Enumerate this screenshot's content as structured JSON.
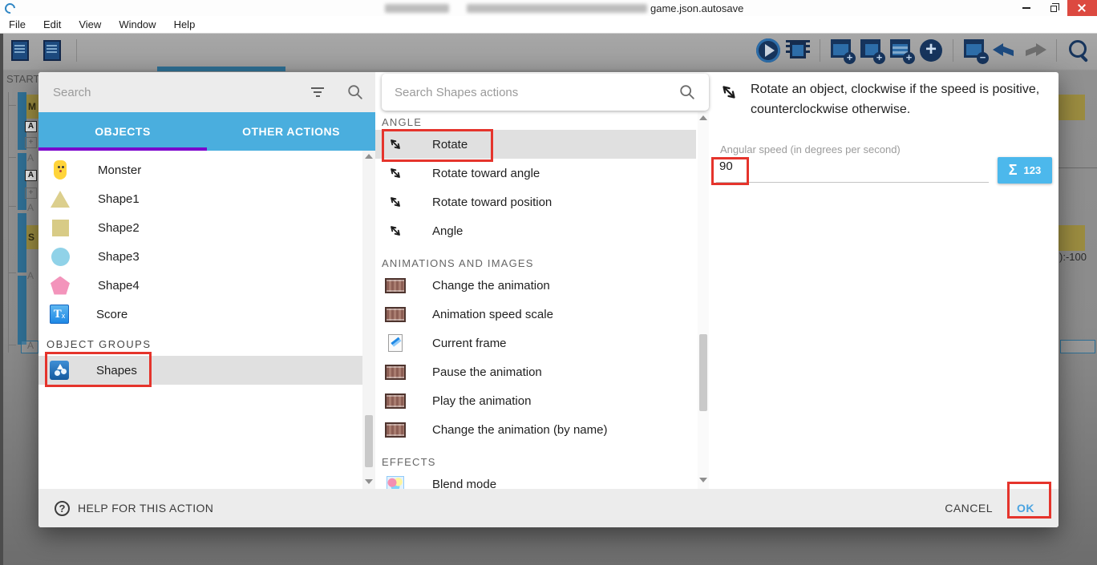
{
  "window": {
    "title": "game.json.autosave"
  },
  "menu": {
    "items": [
      "File",
      "Edit",
      "View",
      "Window",
      "Help"
    ]
  },
  "toolbar": {
    "left_icons": [
      "project-manager",
      "scene-editor"
    ],
    "right_icons": [
      "play",
      "debug",
      "add-event",
      "add-subevent",
      "add-comment",
      "add-circle",
      "delete-event",
      "undo",
      "redo",
      "search"
    ]
  },
  "background": {
    "scene_tab": "START",
    "comment_m": "M",
    "comment_s": "S",
    "action_letter": "A",
    "add_letter": "+",
    "right_text": "):-100"
  },
  "dialog": {
    "objects_panel": {
      "search_placeholder": "Search",
      "tabs": [
        {
          "label": "OBJECTS",
          "active": true
        },
        {
          "label": "OTHER ACTIONS",
          "active": false
        }
      ],
      "objects": [
        {
          "label": "Monster",
          "icon": "monster"
        },
        {
          "label": "Shape1",
          "icon": "triangle"
        },
        {
          "label": "Shape2",
          "icon": "square"
        },
        {
          "label": "Shape3",
          "icon": "circle"
        },
        {
          "label": "Shape4",
          "icon": "pentagon"
        },
        {
          "label": "Score",
          "icon": "text"
        }
      ],
      "groups_header": "OBJECT GROUPS",
      "groups": [
        {
          "label": "Shapes",
          "icon": "group",
          "selected": true
        }
      ]
    },
    "actions_panel": {
      "search_placeholder": "Search Shapes actions",
      "sections": [
        {
          "header": "ANGLE",
          "items": [
            {
              "label": "Rotate",
              "icon": "rotate-arrow",
              "selected": true
            },
            {
              "label": "Rotate toward angle",
              "icon": "rotate-arrow"
            },
            {
              "label": "Rotate toward position",
              "icon": "rotate-arrow"
            },
            {
              "label": "Angle",
              "icon": "rotate-arrow"
            }
          ]
        },
        {
          "header": "ANIMATIONS AND IMAGES",
          "items": [
            {
              "label": "Change the animation",
              "icon": "filmstrip"
            },
            {
              "label": "Animation speed scale",
              "icon": "filmstrip"
            },
            {
              "label": "Current frame",
              "icon": "frame-doc"
            },
            {
              "label": "Pause the animation",
              "icon": "filmstrip"
            },
            {
              "label": "Play the animation",
              "icon": "filmstrip"
            },
            {
              "label": "Change the animation (by name)",
              "icon": "filmstrip"
            }
          ]
        },
        {
          "header": "EFFECTS",
          "items": [
            {
              "label": "Blend mode",
              "icon": "blend"
            }
          ]
        }
      ]
    },
    "detail_panel": {
      "description": "Rotate an object, clockwise if the speed is positive, counterclockwise otherwise.",
      "field_label": "Angular speed (in degrees per second)",
      "field_value": "90",
      "sigma": "Σ",
      "expression_button": "123"
    },
    "footer": {
      "help_icon": "?",
      "help_label": "HELP FOR THIS ACTION",
      "cancel_label": "CANCEL",
      "ok_label": "OK"
    }
  },
  "colors": {
    "tab_blue": "#4aaede",
    "active_tab_underline": "#7a00cc",
    "selection_gray": "#e0e0e0",
    "annotation_red": "#e5342c",
    "ok_blue": "#4aa3e0",
    "expression_blue": "#4cb8ec",
    "close_red": "#dc4940",
    "comment_yellow": "#9b8c40",
    "event_blue": "#2f6f94"
  }
}
